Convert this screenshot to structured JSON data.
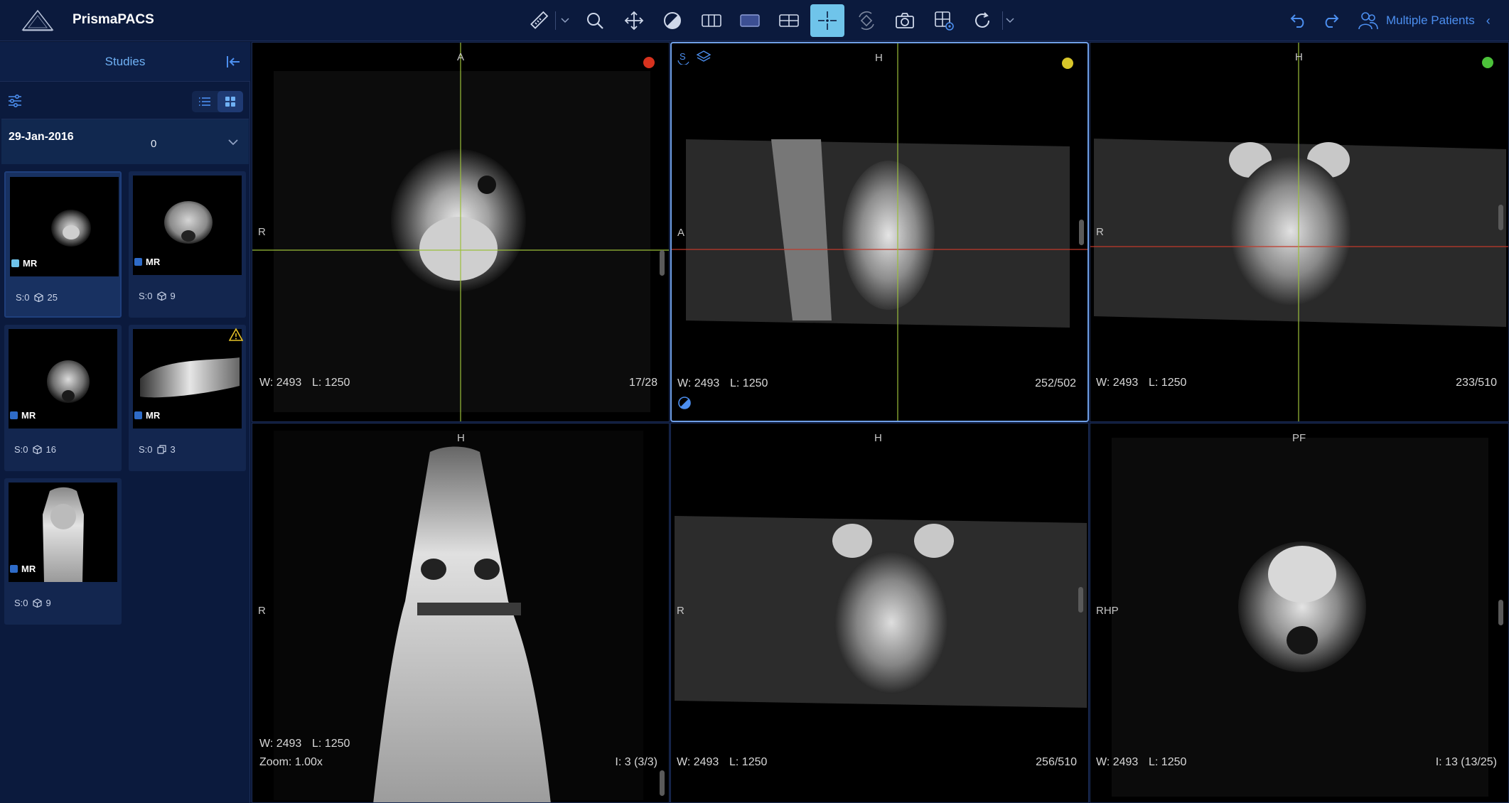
{
  "app": {
    "name": "PrismaPACS"
  },
  "toolbar": {
    "tools": [
      {
        "name": "ruler-tool"
      },
      {
        "name": "zoom-tool"
      },
      {
        "name": "pan-tool"
      },
      {
        "name": "window-level-tool"
      },
      {
        "name": "layout-columns-tool"
      },
      {
        "name": "layout-single-tool"
      },
      {
        "name": "layout-grid-tool"
      },
      {
        "name": "crosshair-tool",
        "active": true
      },
      {
        "name": "rotate-3d-tool"
      },
      {
        "name": "camera-tool"
      },
      {
        "name": "settings-grid-tool"
      },
      {
        "name": "rotate-tool"
      }
    ],
    "patients_label": "Multiple Patients"
  },
  "sidebar": {
    "title": "Studies",
    "study_date": "29-Jan-2016",
    "study_count": "0",
    "series": [
      {
        "modality": "MR",
        "series_no": "S:0",
        "count": "25",
        "count_icon": "cube-icon",
        "selected": true,
        "light": true
      },
      {
        "modality": "MR",
        "series_no": "S:0",
        "count": "9",
        "count_icon": "cube-icon"
      },
      {
        "modality": "MR",
        "series_no": "S:0",
        "count": "16",
        "count_icon": "cube-icon"
      },
      {
        "modality": "MR",
        "series_no": "S:0",
        "count": "3",
        "count_icon": "copy-icon",
        "warning": true
      },
      {
        "modality": "MR",
        "series_no": "S:0",
        "count": "9",
        "count_icon": "cube-icon"
      }
    ]
  },
  "viewports": [
    {
      "top": "A",
      "left": "R",
      "w": "W: 2493",
      "l": "L: 1250",
      "index": "17/28",
      "dot": "#d7321e"
    },
    {
      "top": "H",
      "left": "A",
      "w": "W: 2493",
      "l": "L: 1250",
      "index": "252/502",
      "dot": "#d8c62a",
      "active": true
    },
    {
      "top": "H",
      "left": "R",
      "w": "W: 2493",
      "l": "L: 1250",
      "index": "233/510",
      "dot": "#4cc23a"
    },
    {
      "top": "H",
      "left": "R",
      "w": "W: 2493",
      "l": "L: 1250",
      "zoom": "Zoom: 1.00x",
      "index": "I: 3 (3/3)"
    },
    {
      "top": "H",
      "left": "R",
      "w": "W: 2493",
      "l": "L: 1250",
      "index": "256/510"
    },
    {
      "top": "PF",
      "left": "RHP",
      "w": "W: 2493",
      "l": "L: 1250",
      "index": "I: 13 (13/25)"
    }
  ],
  "colors": {
    "accent": "#6fc4ea",
    "link": "#4c8ff0",
    "bg": "#0a1633"
  }
}
